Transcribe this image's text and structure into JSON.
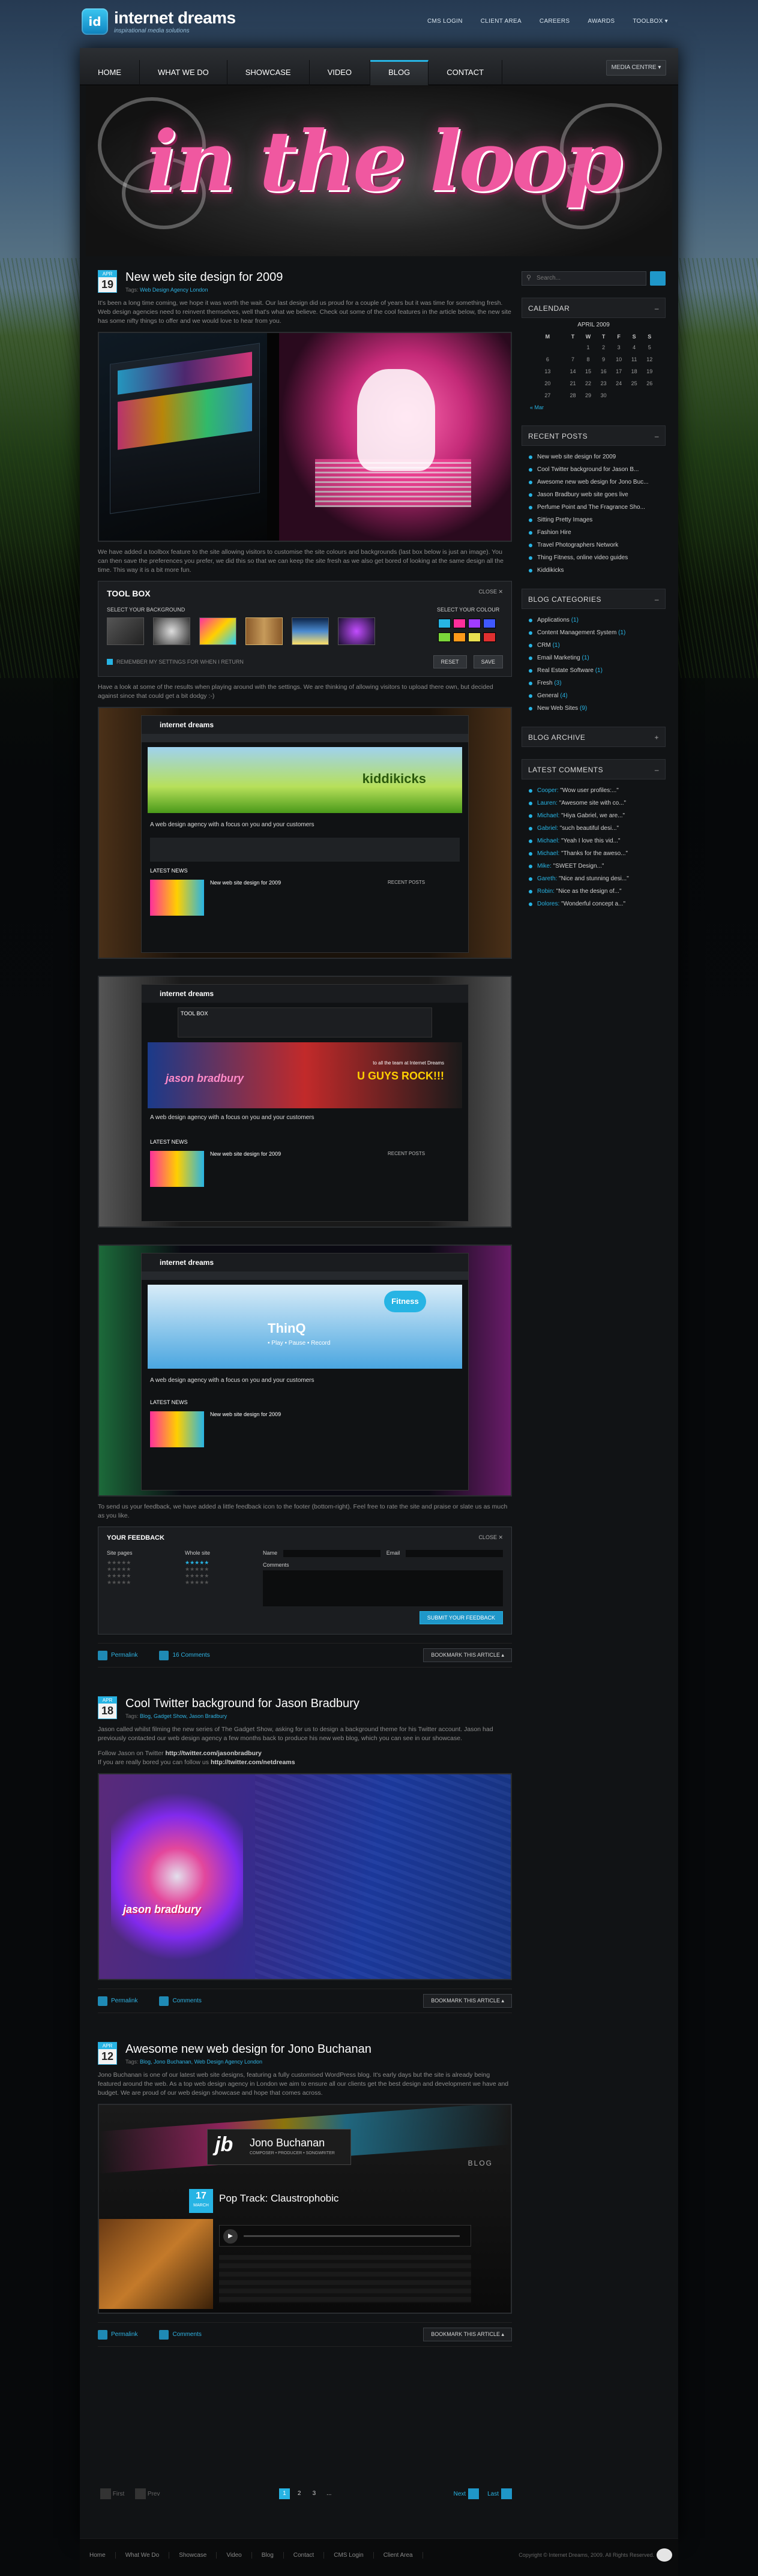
{
  "brand": {
    "name": "internet dreams",
    "tagline": "inspirational media solutions",
    "mark": "id"
  },
  "toplinks": [
    "CMS LOGIN",
    "CLIENT AREA",
    "CAREERS",
    "AWARDS",
    "TOOLBOX ▾"
  ],
  "nav": {
    "items": [
      "HOME",
      "WHAT WE DO",
      "SHOWCASE",
      "VIDEO",
      "BLOG",
      "CONTACT"
    ],
    "active": "BLOG",
    "media": "MEDIA CENTRE ▾"
  },
  "banner": {
    "title": "in the loop"
  },
  "posts": [
    {
      "month": "APR",
      "day": "19",
      "title": "New web site design for 2009",
      "tags_label": "Tags:",
      "tags": "Web Design Agency London",
      "p1": "It's been a long time coming, we hope it was worth the wait. Our last design did us proud for a couple of years but it was time for something fresh. Web design agencies need to reinvent themselves, well that's what we believe. Check out some of the cool features in the article below, the new site has some nifty things to offer and we would love to hear from you.",
      "p2": "We have added a toolbox feature to the site allowing visitors to customise the site colours and backgrounds (last box below is just an image). You can then save the preferences you prefer, we did this so that we can keep the site fresh as we also get bored of looking at the same design all the time. This way it is a bit more fun.",
      "p3": "Have a look at some of the results when playing around with the settings. We are thinking of allowing visitors to upload there own, but decided against since that could get a bit dodgy :-)",
      "p4": "To send us your feedback, we have added a little feedback icon to the footer (bottom-right). Feel free to rate the site and praise or slate us as much as you like.",
      "permalink": "Permalink",
      "comments": "16 Comments",
      "bookmark": "BOOKMARK THIS ARTICLE ▴"
    },
    {
      "month": "APR",
      "day": "18",
      "title": "Cool Twitter background for Jason Bradbury",
      "tags_label": "Tags:",
      "tags": "Blog, Gadget Show, Jason Bradbury",
      "p1": "Jason called whilst filming the new series of The Gadget Show, asking for us to design a background theme for his Twitter account. Jason had previously contacted our web design agency a few months back to produce his new web blog, which you can see in our showcase.",
      "p2a": "Follow Jason on Twitter ",
      "p2b": "http://twitter.com/jasonbradbury",
      "p2c": "If you are really bored you can follow us ",
      "p2d": "http://twitter.com/netdreams",
      "permalink": "Permalink",
      "comments": "Comments",
      "bookmark": "BOOKMARK THIS ARTICLE ▴"
    },
    {
      "month": "APR",
      "day": "12",
      "title": "Awesome new web design for Jono Buchanan",
      "tags_label": "Tags:",
      "tags": "Blog, Jono Buchanan, Web Design Agency London",
      "p1": "Jono Buchanan is one of our latest web site designs, featuring a fully customised WordPress blog. It's early days but the site is already being featured around the web. As a top web design agency in London we aim to ensure all our clients get the best design and development we have and budget. We are proud of our web design showcase and hope that comes across.",
      "permalink": "Permalink",
      "comments": "Comments",
      "bookmark": "BOOKMARK THIS ARTICLE ▴"
    }
  ],
  "toolbox": {
    "title": "TOOL BOX",
    "close": "CLOSE ✕",
    "bg_label": "SELECT YOUR BACKGROUND",
    "colour_label": "SELECT YOUR COLOUR",
    "remember": "REMEMBER MY SETTINGS FOR WHEN I RETURN",
    "reset": "RESET",
    "save": "SAVE"
  },
  "feedback": {
    "title": "YOUR FEEDBACK",
    "close": "CLOSE ✕",
    "name_label": "Name",
    "email_label": "Email",
    "comments_label": "Comments",
    "submit": "SUBMIT YOUR FEEDBACK",
    "col1": "Site pages",
    "col2": "Whole site"
  },
  "shot1": {
    "brand": "internet dreams",
    "hero": "kiddikicks",
    "headline": "A web design agency with a focus on you and your customers",
    "news": "LATEST NEWS",
    "post": "New web site design for 2009",
    "recent": "RECENT POSTS"
  },
  "shot2": {
    "toolbox": "TOOL BOX",
    "hero1": "to all the team at Internet Dreams",
    "hero2": "U GUYS ROCK!!!",
    "hero3": "jason bradbury"
  },
  "shot3": {
    "hero": "ThinQ",
    "fitness": "Fitness",
    "tags": "• Play  • Pause  • Record"
  },
  "shot_jono": {
    "name": "Jono Buchanan",
    "sub": "COMPOSER • PRODUCER • SONGWRITER",
    "blog": "BLOG",
    "day": "17",
    "month": "MARCH",
    "title": "Pop Track: Claustrophobic"
  },
  "shot_jason": {
    "name": "jason bradbury"
  },
  "sidebar": {
    "search_placeholder": "Search...",
    "calendar_title": "CALENDAR",
    "calendar_month": "APRIL 2009",
    "days": [
      "M",
      "T",
      "W",
      "T",
      "F",
      "S",
      "S"
    ],
    "weeks": [
      [
        "",
        "",
        "1",
        "2",
        "3",
        "4",
        "5"
      ],
      [
        "6",
        "7",
        "8",
        "9",
        "10",
        "11",
        "12"
      ],
      [
        "13",
        "14",
        "15",
        "16",
        "17",
        "18",
        "19"
      ],
      [
        "20",
        "21",
        "22",
        "23",
        "24",
        "25",
        "26"
      ],
      [
        "27",
        "28",
        "29",
        "30",
        "",
        "",
        ""
      ],
      [
        "« Mar",
        "",
        "",
        "",
        "",
        "",
        ""
      ]
    ],
    "recent_title": "RECENT POSTS",
    "recent": [
      "New web site design for 2009",
      "Cool Twitter background for Jason B...",
      "Awesome new web design for Jono Buc...",
      "Jason Bradbury web site goes live",
      "Perfume Point and The Fragrance Sho...",
      "Sitting Pretty Images",
      "Fashion Hire",
      "Travel Photographers Network",
      "Thing Fitness, online video guides",
      "Kiddikicks"
    ],
    "categories_title": "BLOG CATEGORIES",
    "categories": [
      {
        "name": "Applications",
        "count": "(1)"
      },
      {
        "name": "Content Management System",
        "count": "(1)"
      },
      {
        "name": "CRM",
        "count": "(1)"
      },
      {
        "name": "Email Marketing",
        "count": "(1)"
      },
      {
        "name": "Real Estate Software",
        "count": "(1)"
      },
      {
        "name": "Fresh",
        "count": "(3)"
      },
      {
        "name": "General",
        "count": "(4)"
      },
      {
        "name": "New Web Sites",
        "count": "(9)"
      }
    ],
    "archive_title": "BLOG ARCHIVE",
    "comments_title": "LATEST COMMENTS",
    "comments": [
      {
        "who": "Cooper:",
        "text": " \"Wow user profiles:...\""
      },
      {
        "who": "Lauren:",
        "text": " \"Awesome site with co...\""
      },
      {
        "who": "Michael:",
        "text": " \"Hiya Gabriel, we are...\""
      },
      {
        "who": "Gabriel:",
        "text": " \"such beautiful desi...\""
      },
      {
        "who": "Michael:",
        "text": " \"Yeah I love this vid...\""
      },
      {
        "who": "Michael:",
        "text": " \"Thanks for the aweso...\""
      },
      {
        "who": "Mike:",
        "text": " \"SWEET Design...\""
      },
      {
        "who": "Gareth:",
        "text": " \"Nice and stunning desi...\""
      },
      {
        "who": "Robin:",
        "text": " \"Nice as the design of...\""
      },
      {
        "who": "Dolores:",
        "text": " \"Wonderful concept a...\""
      }
    ]
  },
  "pager": {
    "first": "First",
    "prev": "Prev",
    "pages": [
      "1",
      "2",
      "3",
      "..."
    ],
    "current": "1",
    "next": "Next",
    "last": "Last"
  },
  "footer": {
    "links": [
      "Home",
      "What We Do",
      "Showcase",
      "Video",
      "Blog",
      "Contact",
      "CMS Login",
      "Client Area"
    ],
    "copy": "Copyright © Internet Dreams, 2009. All Rights Reserved."
  },
  "colors": {
    "accent": "#27b4e4",
    "banner_pink": "#f058a0"
  }
}
